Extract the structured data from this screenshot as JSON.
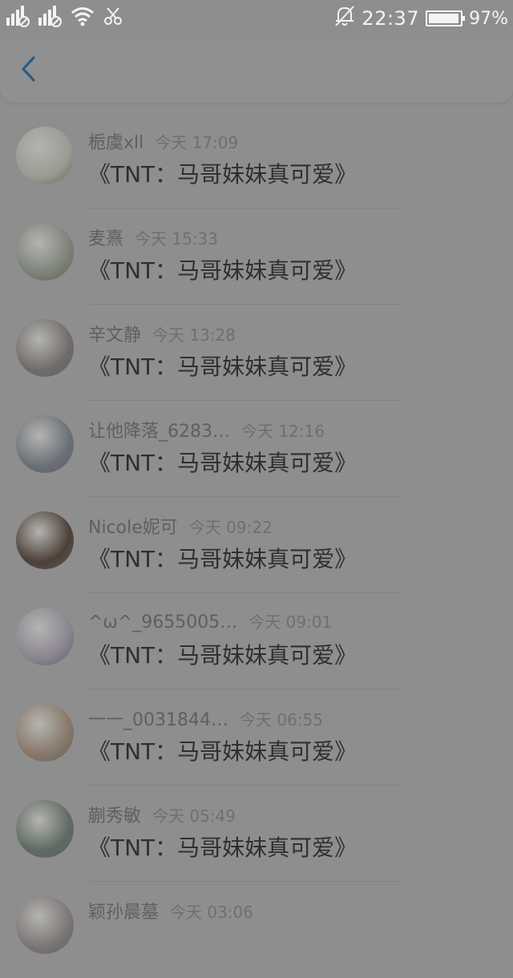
{
  "status_bar": {
    "time": "22:37",
    "battery_percent": "97%",
    "battery_level": 0.97,
    "icons": [
      "signal-1-icon",
      "signal-2-icon",
      "wifi-icon",
      "scissors-icon",
      "bell-off-icon",
      "battery-icon"
    ]
  },
  "nav": {
    "back_icon": "chevron-left-icon"
  },
  "items": [
    {
      "name": "栀虞xll",
      "time": "今天 17:09",
      "content": "《TNT：马哥妹妹真可爱》",
      "avatar_color": "#9a9a93"
    },
    {
      "name": "麦熹",
      "time": "今天 15:33",
      "content": "《TNT：马哥妹妹真可爱》",
      "avatar_color": "#7d8279"
    },
    {
      "name": "辛文静",
      "time": "今天 13:28",
      "content": "《TNT：马哥妹妹真可爱》",
      "avatar_color": "#706c6b"
    },
    {
      "name": "让他降落_6283…",
      "time": "今天 12:16",
      "content": "《TNT：马哥妹妹真可爱》",
      "avatar_color": "#6b7078"
    },
    {
      "name": "Nicole妮可",
      "time": "今天 09:22",
      "content": "《TNT：马哥妹妹真可爱》",
      "avatar_color": "#4d4038"
    },
    {
      "name": "^ω^_9655005…",
      "time": "今天 09:01",
      "content": "《TNT：马哥妹妹真可爱》",
      "avatar_color": "#8a8590"
    },
    {
      "name": "一一_0031844…",
      "time": "今天 06:55",
      "content": "《TNT：马哥妹妹真可爱》",
      "avatar_color": "#87786a"
    },
    {
      "name": "蒯秀敏",
      "time": "今天 05:49",
      "content": "《TNT：马哥妹妹真可爱》",
      "avatar_color": "#5f6a63"
    },
    {
      "name": "颖孙晨墓",
      "time": "今天 03:06",
      "content": "",
      "avatar_color": "#7b7676"
    }
  ]
}
